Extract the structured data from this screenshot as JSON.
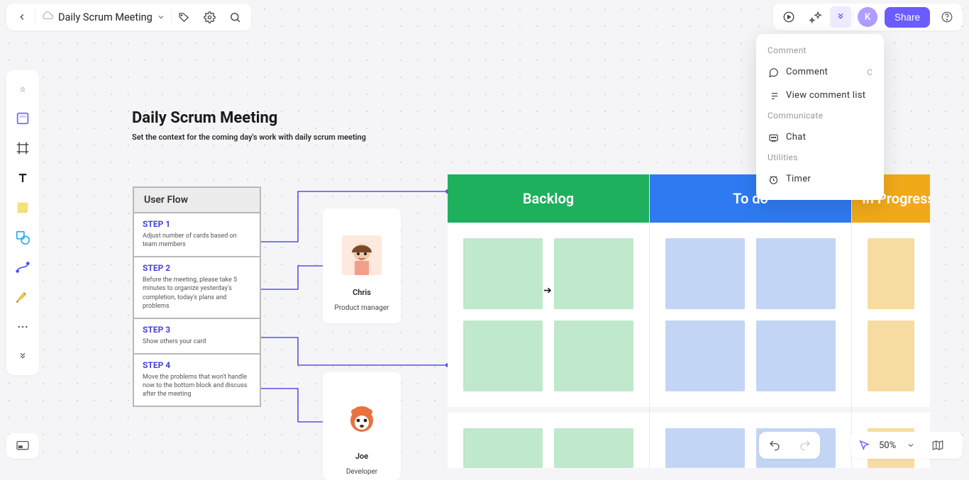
{
  "header": {
    "doc_title": "Daily Scrum Meeting",
    "share_label": "Share",
    "avatar_letter": "K"
  },
  "dropdown": {
    "sections": [
      {
        "title": "Comment",
        "items": [
          {
            "icon": "comment",
            "label": "Comment",
            "shortcut": "C"
          },
          {
            "icon": "list",
            "label": "View comment list",
            "shortcut": ""
          }
        ]
      },
      {
        "title": "Communicate",
        "items": [
          {
            "icon": "chat",
            "label": "Chat",
            "shortcut": ""
          }
        ]
      },
      {
        "title": "Utilities",
        "items": [
          {
            "icon": "timer",
            "label": "Timer",
            "shortcut": ""
          }
        ]
      }
    ]
  },
  "canvas": {
    "title": "Daily Scrum Meeting",
    "subtitle": "Set the context for the coming day's work with daily scrum meeting"
  },
  "userflow": {
    "header": "User Flow",
    "steps": [
      {
        "title": "STEP 1",
        "text": "Adjust number of cards based on team members"
      },
      {
        "title": "STEP 2",
        "text": "Before the meeting, please take 5 minutes to organize yesterday's completion, today's plans and problems"
      },
      {
        "title": "STEP 3",
        "text": "Show others your card"
      },
      {
        "title": "STEP 4",
        "text": "Move the problems that won't handle now to the bottom block and discuss after the meeting"
      }
    ]
  },
  "people": {
    "chris": {
      "name": "Chris",
      "role": "Product manager"
    },
    "joe": {
      "name": "Joe",
      "role": "Developer"
    }
  },
  "kanban": {
    "columns": [
      {
        "key": "backlog",
        "label": "Backlog"
      },
      {
        "key": "todo",
        "label": "To do"
      },
      {
        "key": "inprog",
        "label": "In Progress"
      }
    ]
  },
  "bottom": {
    "zoom": "50%"
  }
}
